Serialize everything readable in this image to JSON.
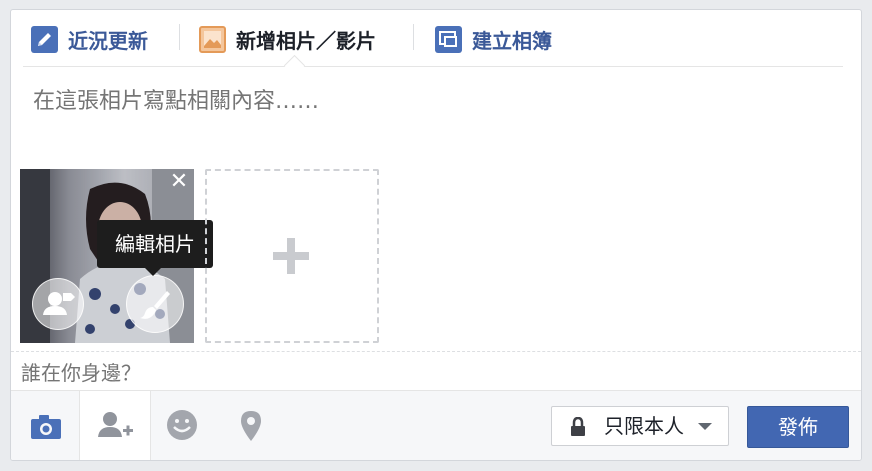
{
  "tabs": [
    {
      "label": "近況更新",
      "icon": "pencil-icon"
    },
    {
      "label": "新增相片／影片",
      "icon": "photo-icon"
    },
    {
      "label": "建立相簿",
      "icon": "album-icon"
    }
  ],
  "composer": {
    "placeholder": "在這張相片寫點相關內容……"
  },
  "photo": {
    "close_label": "✕",
    "tooltip": "編輯相片"
  },
  "with": {
    "placeholder": "誰在你身邊？"
  },
  "footer": {
    "privacy_label": "只限本人",
    "post_label": "發佈"
  },
  "colors": {
    "brand": "#4267b2",
    "tab_link": "#3b5998",
    "placeholder": "#90949c"
  }
}
